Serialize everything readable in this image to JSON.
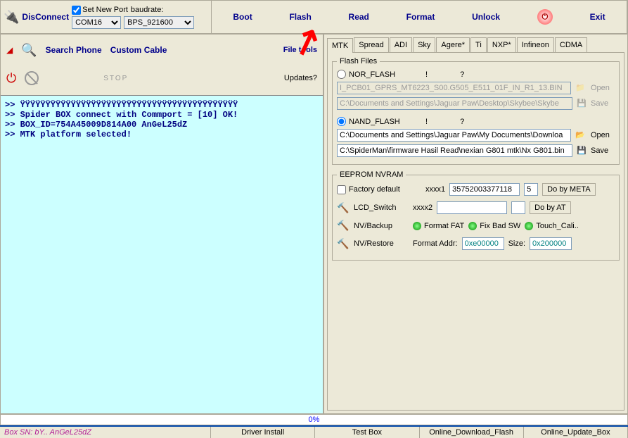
{
  "toolbar": {
    "disconnect": "DisConnect",
    "set_new_port": "Set New Port",
    "baudrate_label": "baudrate:",
    "port_value": "COM16",
    "baud_value": "BPS_921600",
    "buttons": {
      "boot": "Boot",
      "flash": "Flash",
      "read": "Read",
      "format": "Format",
      "unlock": "Unlock",
      "exit": "Exit"
    }
  },
  "left": {
    "search_phone": "Search Phone",
    "custom_cable": "Custom Cable",
    "file_tools": "File tools",
    "stop": "STOP",
    "updates": "Updates?"
  },
  "console": ">> ŸŸŸŸŸŸŸŸŸŸŸŸŸŸŸŸŸŸŸŸŸŸŸŸŸŸŸŸŸŸŸŸŸŸŸŸŸŸŸŸŸŸŸ\n>> Spider BOX connect with Commport = [10] OK!\n>> BOX_ID=754A45009D814A00 AnGeL25dZ\n>> MTK platform selected!",
  "tabs": [
    "MTK",
    "Spread",
    "ADI",
    "Sky",
    "Agere*",
    "Ti",
    "NXP*",
    "Infineon",
    "CDMA"
  ],
  "flash_files": {
    "legend": "Flash Files",
    "nor_label": "NOR_FLASH",
    "nand_label": "NAND_FLASH",
    "qmark": "?",
    "bang": "!",
    "path_nor1": "I_PCB01_GPRS_MT6223_S00.G505_E511_01F_IN_R1_13.BIN",
    "path_nor2": "C:\\Documents and Settings\\Jaguar Paw\\Desktop\\Skybee\\Skybe",
    "path_nand1": "C:\\Documents and Settings\\Jaguar Paw\\My Documents\\Downloa",
    "path_nand2": "C:\\SpiderMan\\firmware Hasil Read\\nexian G801 mtk\\Nx G801.bin",
    "open": "Open",
    "save": "Save"
  },
  "eeprom": {
    "legend": "EEPROM NVRAM",
    "factory_default": "Factory default",
    "xxxx1": "xxxx1",
    "xxxx2": "xxxx2",
    "val1": "35752003377118",
    "val1b": "5",
    "do_meta": "Do by META",
    "do_at": "Do by AT",
    "lcd": "LCD_Switch",
    "backup": "NV/Backup",
    "restore": "NV/Restore",
    "format_fat": "Format FAT",
    "fix_bad": "Fix Bad SW",
    "touch": "Touch_Cali..",
    "format_addr_label": "Format Addr:",
    "format_addr": "0xe00000",
    "size_label": "Size:",
    "size": "0x200000"
  },
  "progress": "0%",
  "status": {
    "box_sn": "Box SN: bY.. AnGeL25dZ",
    "driver": "Driver Install",
    "test": "Test Box",
    "download": "Online_Download_Flash",
    "update": "Online_Update_Box"
  }
}
